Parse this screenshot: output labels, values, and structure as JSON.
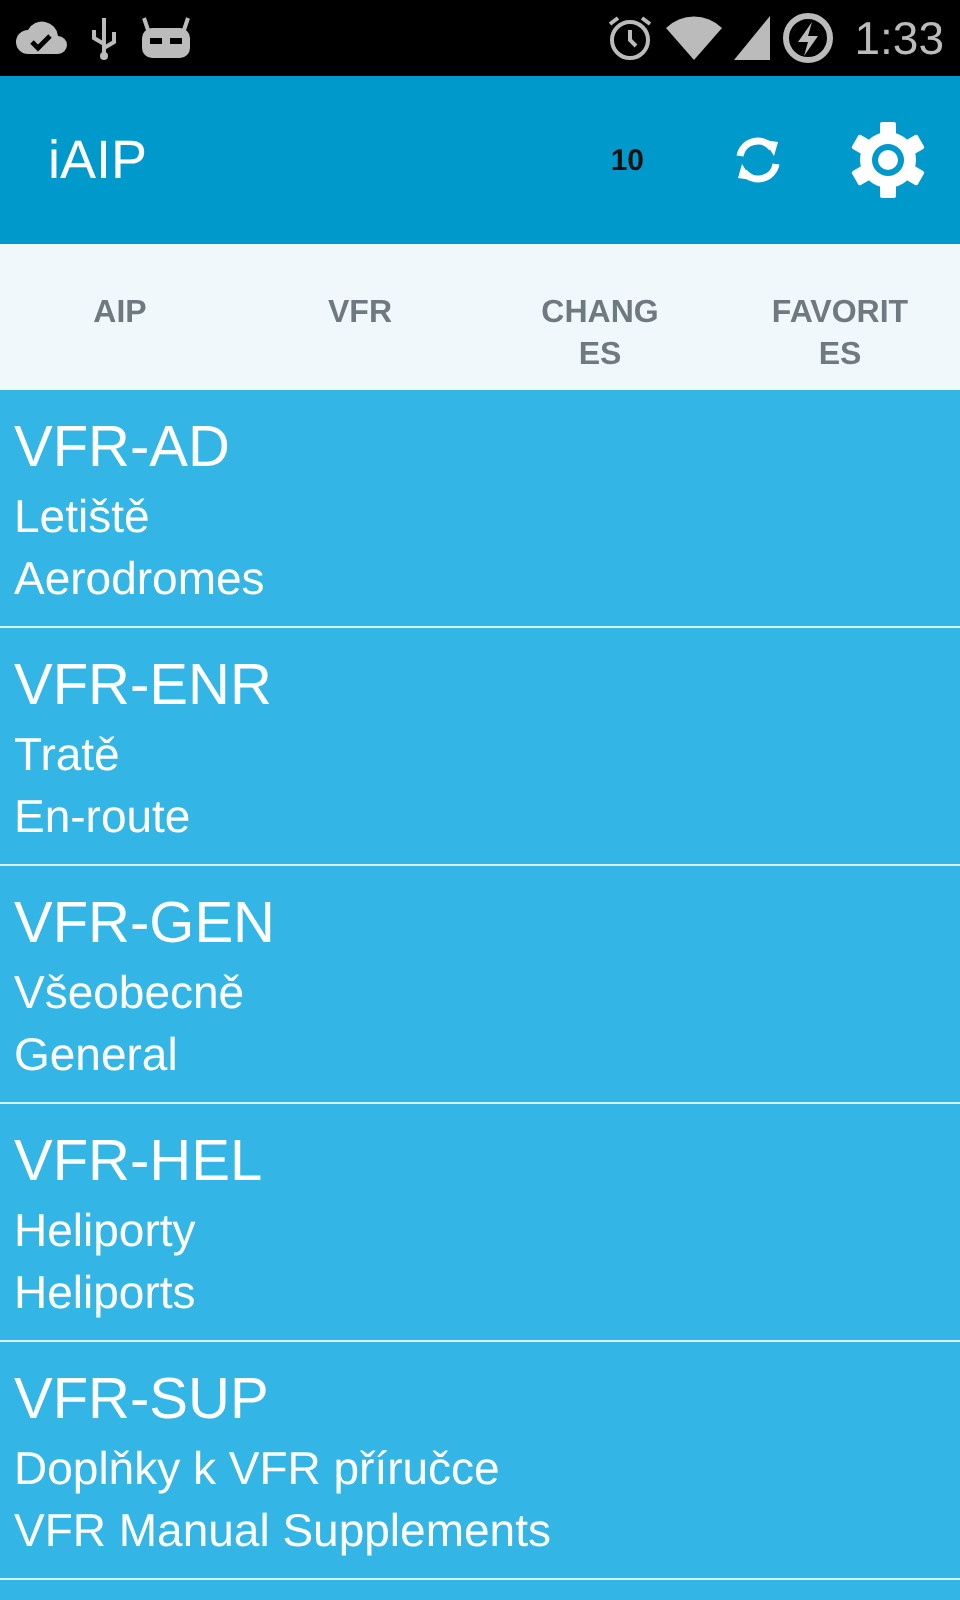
{
  "status_bar": {
    "time": "1:33"
  },
  "app_bar": {
    "title": "iAIP",
    "count": "10"
  },
  "tabs": [
    {
      "label": "AIP"
    },
    {
      "label": "VFR"
    },
    {
      "label": "CHANG ES"
    },
    {
      "label": "FAVORIT ES"
    }
  ],
  "items": [
    {
      "code": "VFR-AD",
      "name_cs": "Letiště",
      "name_en": "Aerodromes"
    },
    {
      "code": "VFR-ENR",
      "name_cs": "Tratě",
      "name_en": "En-route"
    },
    {
      "code": "VFR-GEN",
      "name_cs": "Všeobecně",
      "name_en": "General"
    },
    {
      "code": "VFR-HEL",
      "name_cs": "Heliporty",
      "name_en": "Heliports"
    },
    {
      "code": "VFR-SUP",
      "name_cs": "Doplňky k VFR příručce",
      "name_en": "VFR Manual Supplements"
    }
  ]
}
